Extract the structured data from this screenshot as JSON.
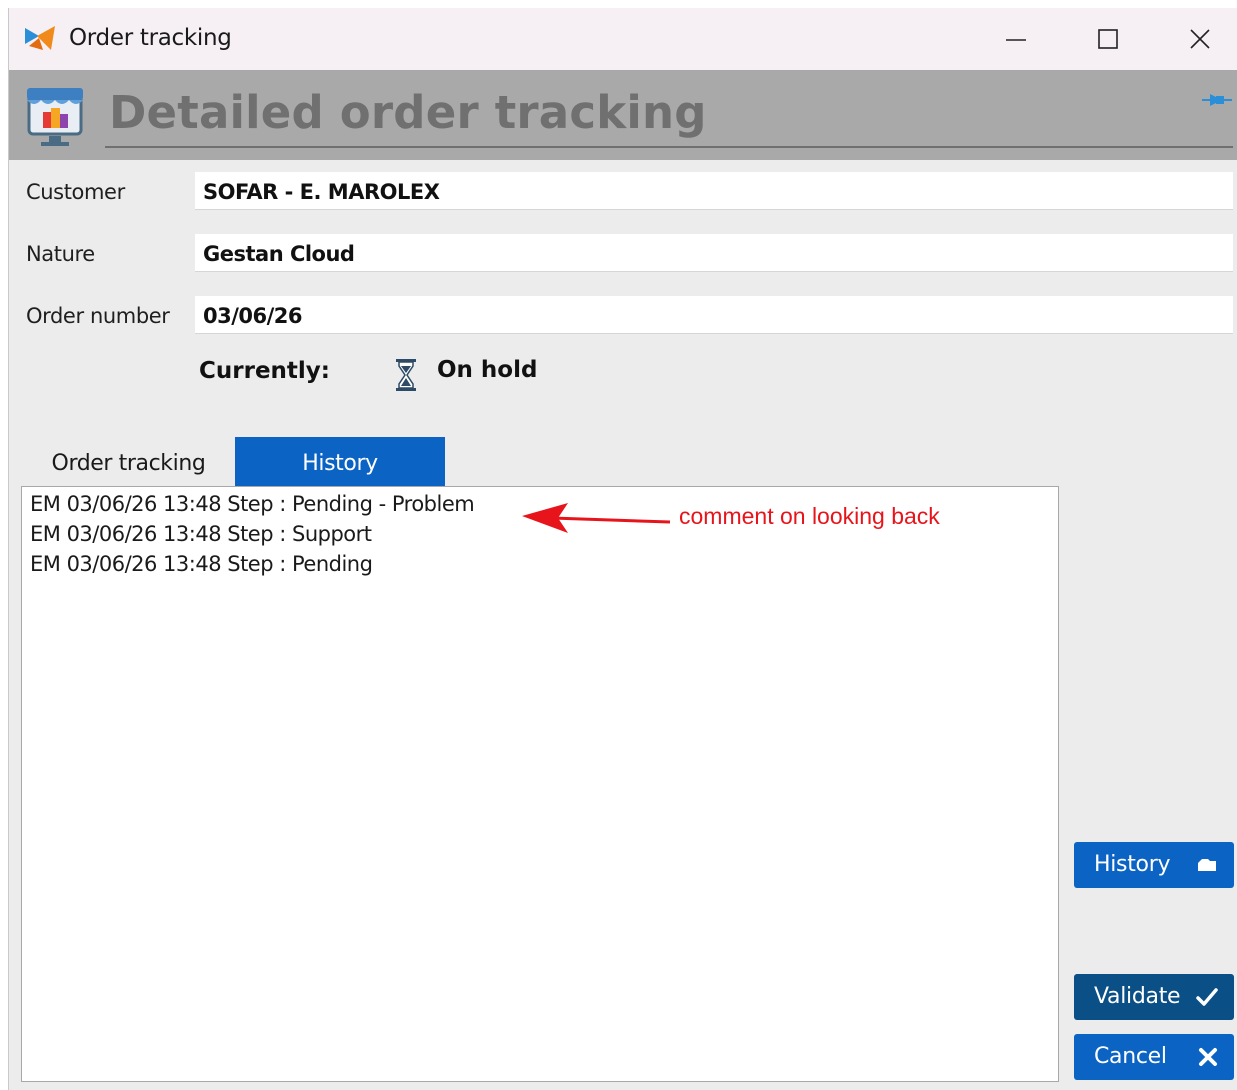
{
  "window": {
    "title": "Order tracking"
  },
  "header": {
    "title": "Detailed order tracking"
  },
  "form": {
    "customer_label": "Customer",
    "customer_value": "SOFAR - E. MAROLEX",
    "nature_label": "Nature",
    "nature_value": "Gestan Cloud",
    "order_number_label": "Order number",
    "order_number_value": "03/06/26",
    "status_label": "Currently:",
    "status_value": "On hold"
  },
  "tabs": [
    {
      "label": "Order tracking",
      "active": false
    },
    {
      "label": "History",
      "active": true
    }
  ],
  "log": {
    "lines": [
      "EM 03/06/26 13:48 Step : Pending - Problem",
      "EM 03/06/26 13:48 Step  : Support",
      "EM 03/06/26 13:48 Step  : Pending"
    ],
    "annotation": "comment on looking back"
  },
  "buttons": {
    "history_label": "History",
    "validate_label": "Validate",
    "cancel_label": "Cancel"
  },
  "colors": {
    "accent_blue": "#0b63c4",
    "dark_blue": "#0a4f86",
    "annotation_red": "#e8141c",
    "header_gray": "#a9a9a9"
  },
  "icons": {
    "app": "app-logo-icon",
    "store": "store-icon",
    "pin": "pin-icon",
    "status": "hourglass-icon",
    "history_button": "folder-icon",
    "validate_button": "checkmark-icon",
    "cancel_button": "close-icon"
  }
}
